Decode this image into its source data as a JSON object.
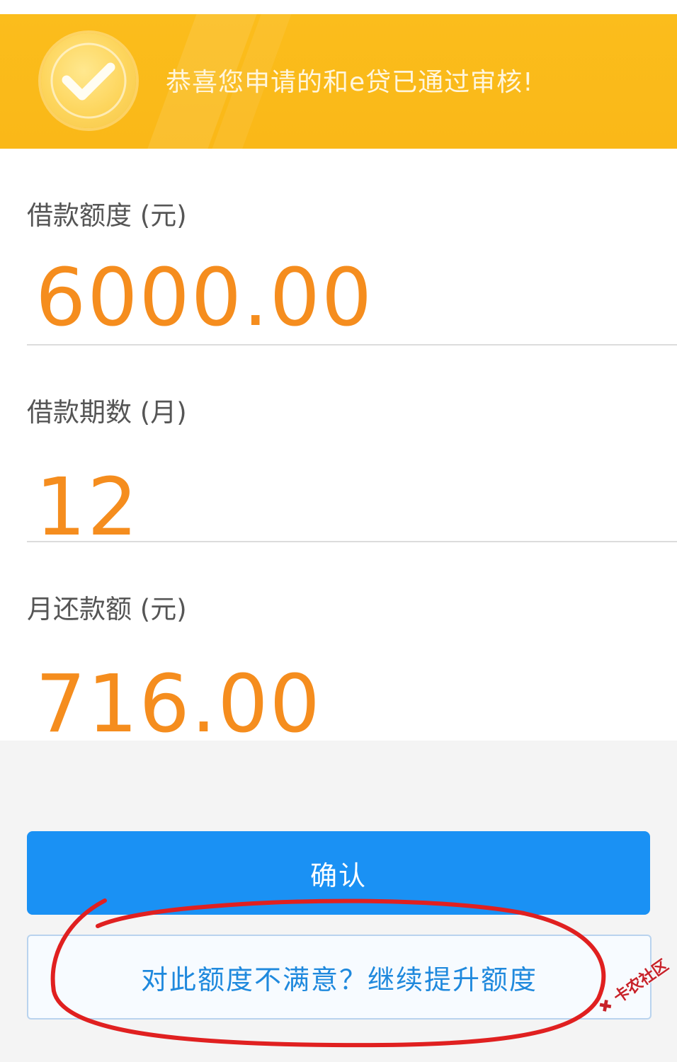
{
  "banner": {
    "message": "恭喜您申请的和e贷已通过审核!",
    "icon": "check-circle-icon",
    "background_color": "#fbbd1c"
  },
  "fields": [
    {
      "label": "借款额度 (元)",
      "value": "6000.00"
    },
    {
      "label": "借款期数 (月)",
      "value": "12"
    },
    {
      "label": "月还款额 (元)",
      "value": "716.00"
    }
  ],
  "buttons": {
    "confirm_label": "确认",
    "upgrade_label": "对此额度不满意？继续提升额度"
  },
  "annotation": {
    "type": "red-hand-drawn-circle",
    "target": "upgrade-button",
    "color": "#e02020"
  },
  "watermark": {
    "text": "卡农社区"
  },
  "colors": {
    "accent_orange": "#f58d1e",
    "primary_blue": "#1a91f4",
    "link_blue": "#1f89dd"
  }
}
